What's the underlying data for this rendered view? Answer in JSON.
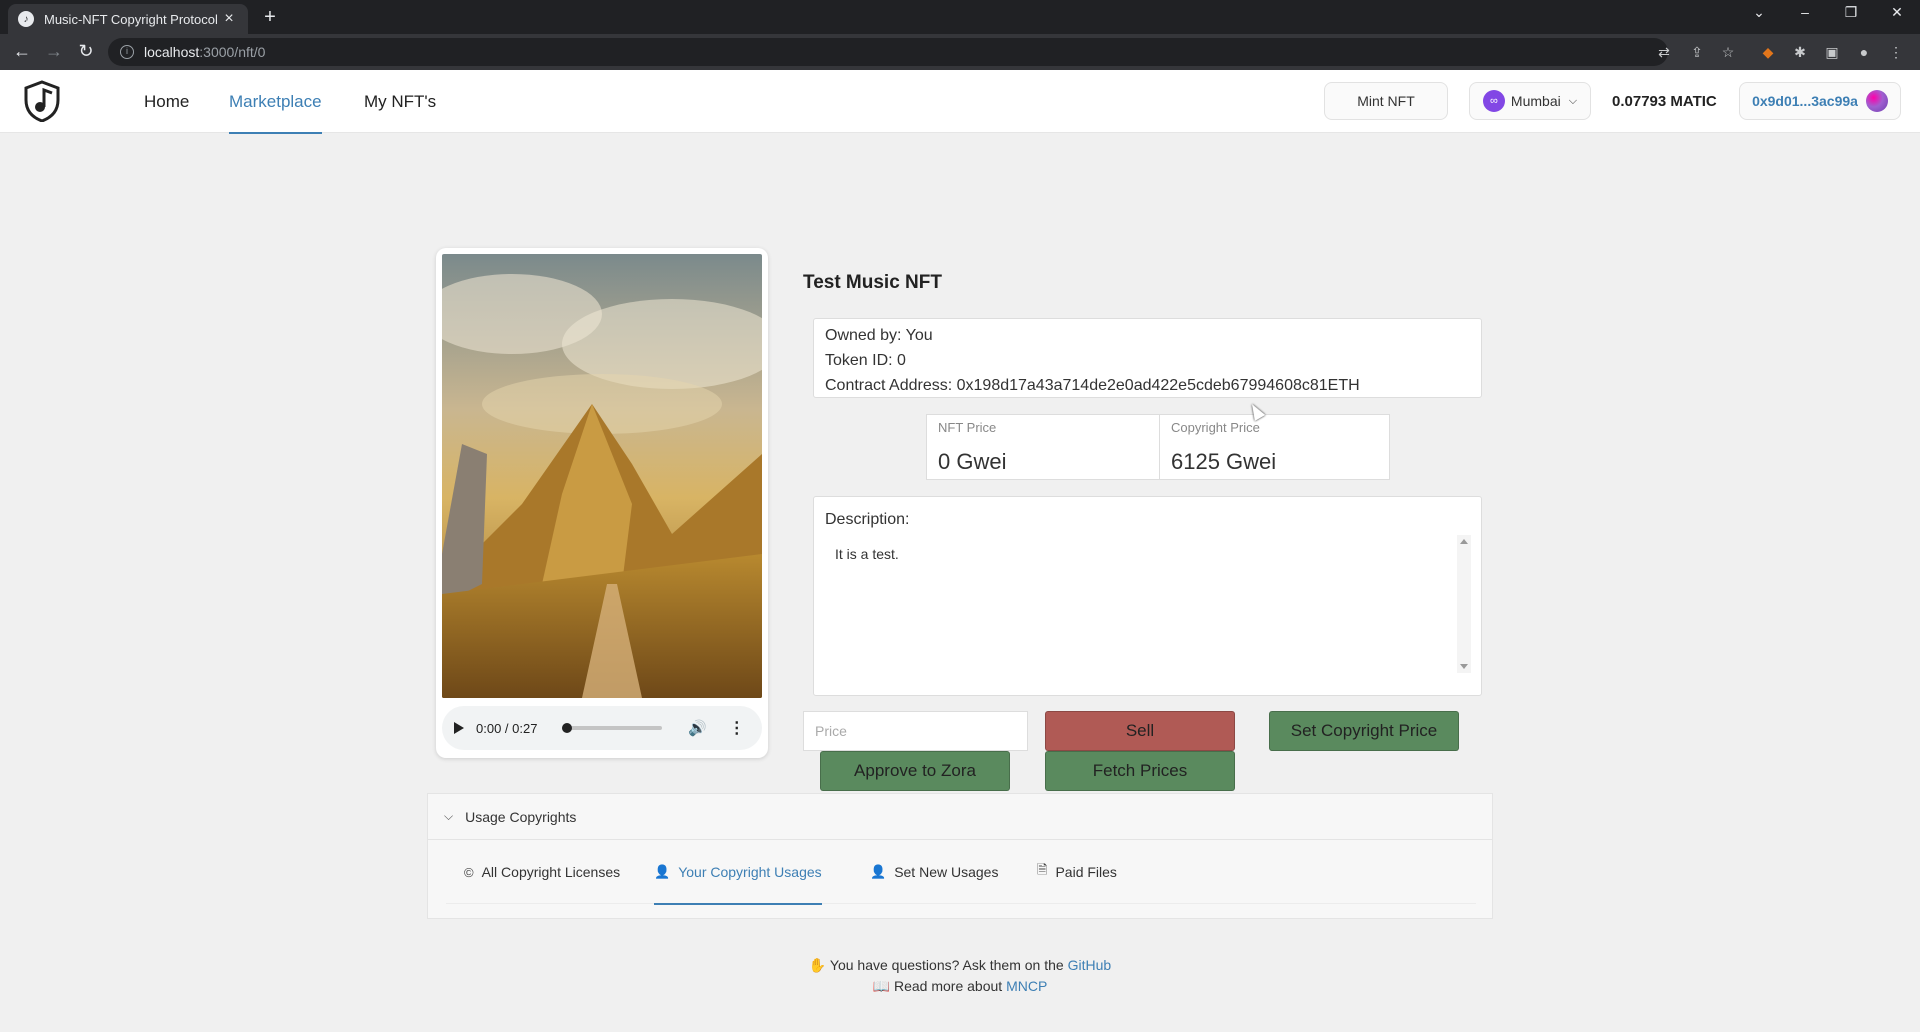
{
  "browser": {
    "tab_title": "Music-NFT Copyright Protocol",
    "url_host": "localhost",
    "url_path": ":3000/nft/0"
  },
  "header": {
    "nav": [
      "Home",
      "Marketplace",
      "My NFT's"
    ],
    "active_nav": "Marketplace",
    "mint_label": "Mint NFT",
    "network": "Mumbai",
    "balance": "0.07793 MATIC",
    "account": "0x9d01...3ac99a"
  },
  "nft": {
    "title": "Test Music NFT",
    "owned_by": "Owned by: You",
    "token_id": "Token ID: 0",
    "contract": "Contract Address: 0x198d17a43a714de2e0ad422e5cdeb67994608c81ETH",
    "nft_price_label": "NFT Price",
    "nft_price": "0 Gwei",
    "copyright_price_label": "Copyright Price",
    "copyright_price": "6125 Gwei",
    "description_label": "Description:",
    "description": "It is a test."
  },
  "player": {
    "time": "0:00 / 0:27",
    "progress": 0
  },
  "actions": {
    "price_placeholder": "Price",
    "sell": "Sell",
    "set_copyright_price": "Set Copyright Price",
    "approve": "Approve to Zora",
    "fetch": "Fetch Prices"
  },
  "usage": {
    "title": "Usage Copyrights",
    "tabs": [
      "All Copyright Licenses",
      "Your Copyright Usages",
      "Set New Usages",
      "Paid Files"
    ],
    "active_tab": "Your Copyright Usages"
  },
  "footer": {
    "line1_prefix": "You have questions? Ask them on the",
    "line1_link": "GitHub",
    "line2_prefix": "Read more about",
    "line2_link": "MNCP"
  },
  "colors": {
    "accent": "#3d7fb4",
    "sell": "#b05a55",
    "green": "#5a8a5e",
    "polygon": "#8247e5"
  }
}
